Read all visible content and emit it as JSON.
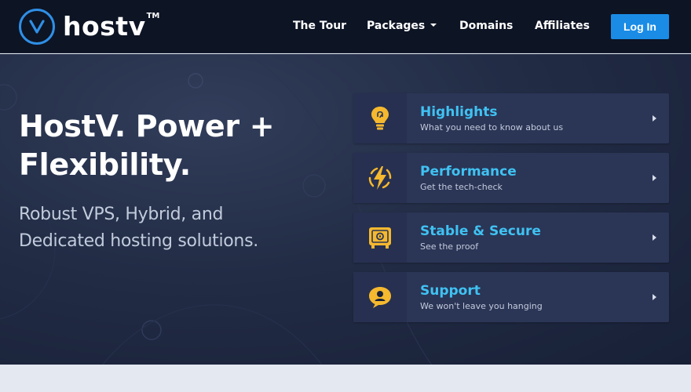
{
  "brand": {
    "name": "hostv",
    "trademark": "TM",
    "logo_icon": "v-circle-logo-icon",
    "accent_color": "#1a8ce6"
  },
  "nav": {
    "items": [
      {
        "label": "The Tour"
      },
      {
        "label": "Packages",
        "has_dropdown": true
      },
      {
        "label": "Domains"
      },
      {
        "label": "Affiliates"
      }
    ],
    "login_label": "Log In"
  },
  "hero": {
    "title": "HostV. Power + Flexibility.",
    "subtitle": "Robust VPS, Hybrid, and Dedicated hosting solutions."
  },
  "features": [
    {
      "title": "Highlights",
      "description": "What you need to know about us",
      "icon": "lightbulb-icon"
    },
    {
      "title": "Performance",
      "description": "Get the tech-check",
      "icon": "lightning-bolt-icon"
    },
    {
      "title": "Stable & Secure",
      "description": "See the proof",
      "icon": "safe-vault-icon"
    },
    {
      "title": "Support",
      "description": "We won't leave you hanging",
      "icon": "chat-bubble-user-icon"
    }
  ],
  "colors": {
    "feature_title": "#3fc2f2",
    "icon_yellow": "#f5b82e"
  }
}
